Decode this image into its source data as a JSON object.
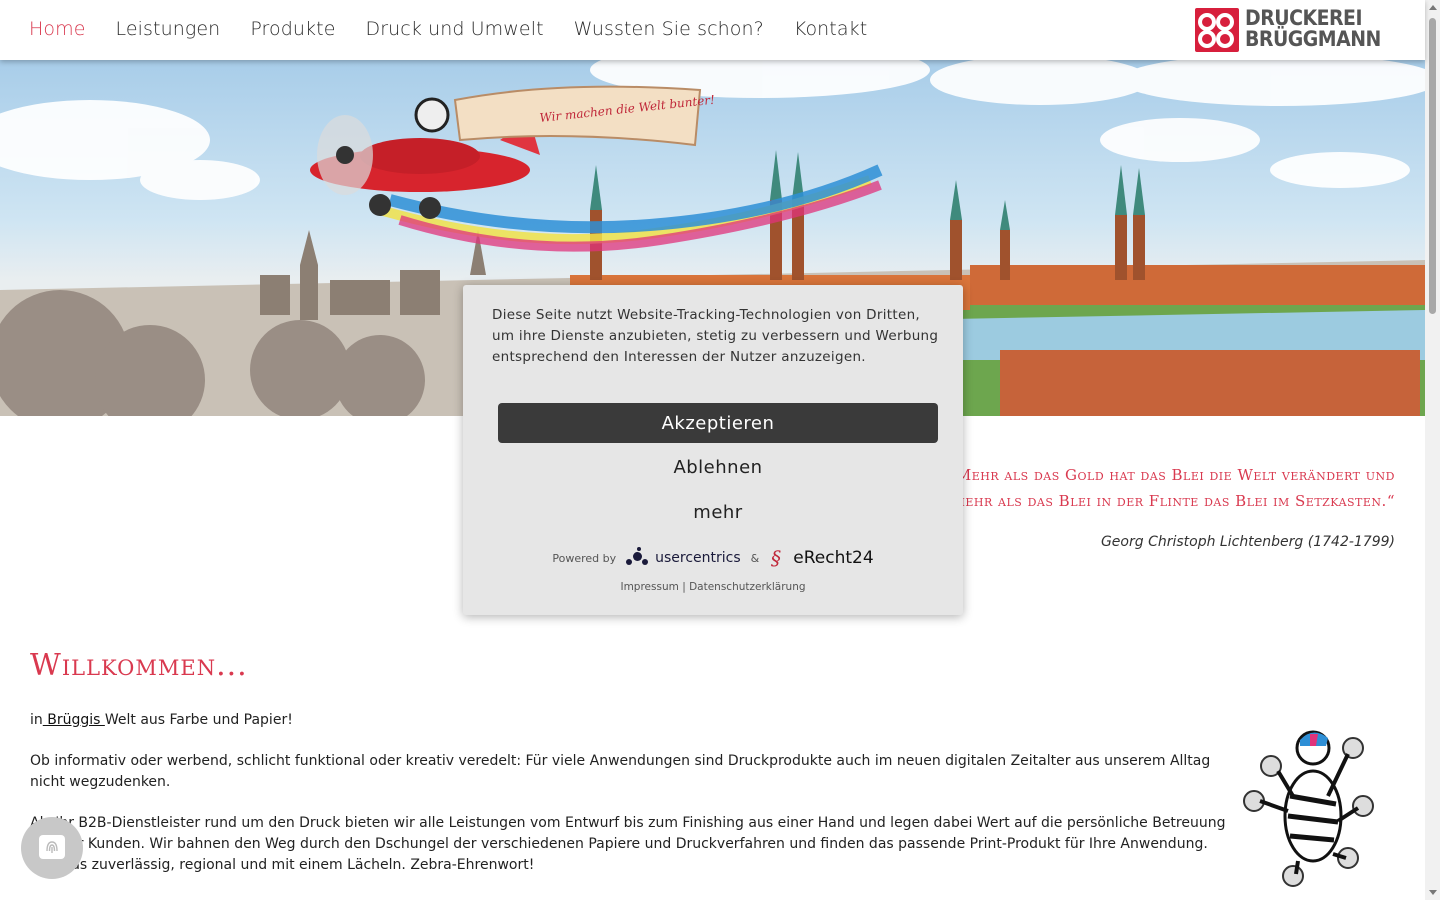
{
  "nav": {
    "items": [
      {
        "label": "Home",
        "active": true
      },
      {
        "label": "Leistungen",
        "active": false
      },
      {
        "label": "Produkte",
        "active": false
      },
      {
        "label": "Druck und Umwelt",
        "active": false
      },
      {
        "label": "Wussten Sie schon?",
        "active": false
      },
      {
        "label": "Kontakt",
        "active": false
      }
    ]
  },
  "logo": {
    "line1": "DRUCKEREI",
    "line2": "BRÜGGMANN",
    "icon": "logo-mark-icon"
  },
  "hero": {
    "banner_text": "Wir machen die Welt bunter!"
  },
  "quote": {
    "text": "„Mehr als das Gold hat das Blei die Welt verändert und mehr als das Blei in der Flinte das Blei im Setzkasten.“",
    "author": "Georg Christoph Lichtenberg (1742-1799)"
  },
  "welcome": {
    "title": "Willkommen...",
    "intro_prefix": "in",
    "intro_link": " Brüggis ",
    "intro_suffix": "Welt aus Farbe und Papier!",
    "para1": "Ob informativ oder werbend, schlicht funktional oder kreativ veredelt: Für viele Anwendungen sind Druckprodukte auch im neuen digitalen Zeitalter aus unserem Alltag nicht wegzudenken.",
    "para2": "Als Ihr B2B-Dienstleister rund um den Druck bieten wir alle Leistungen vom Entwurf bis zum Finishing aus einer Hand und legen dabei Wert auf die persönliche Betreuung unserer Kunden. Wir bahnen den Weg durch den Dschungel der verschiedenen Papiere und Druckverfahren und finden das passende Print-Produkt für Ihre Anwendung. Und das zuverlässig, regional und mit einem Lächeln. Zebra-Ehrenwort!"
  },
  "cookie": {
    "text": "Diese Seite nutzt Website-Tracking-Technologien von Dritten, um ihre Dienste anzubieten, stetig zu verbessern und Werbung entsprechend den Interessen der Nutzer anzuzeigen.",
    "accept": "Akzeptieren",
    "deny": "Ablehnen",
    "more": "mehr",
    "powered_by": "Powered by",
    "usercentrics": "usercentrics",
    "amp": "&",
    "erecht": "eRecht24",
    "imprint": "Impressum",
    "separator": "|",
    "privacy": "Datenschutzerklärung"
  },
  "colors": {
    "accent": "#d9394f",
    "logo_red": "#d71f3c",
    "dialog_bg": "#e6e6e6",
    "accept_bg": "#3a3a3a"
  }
}
